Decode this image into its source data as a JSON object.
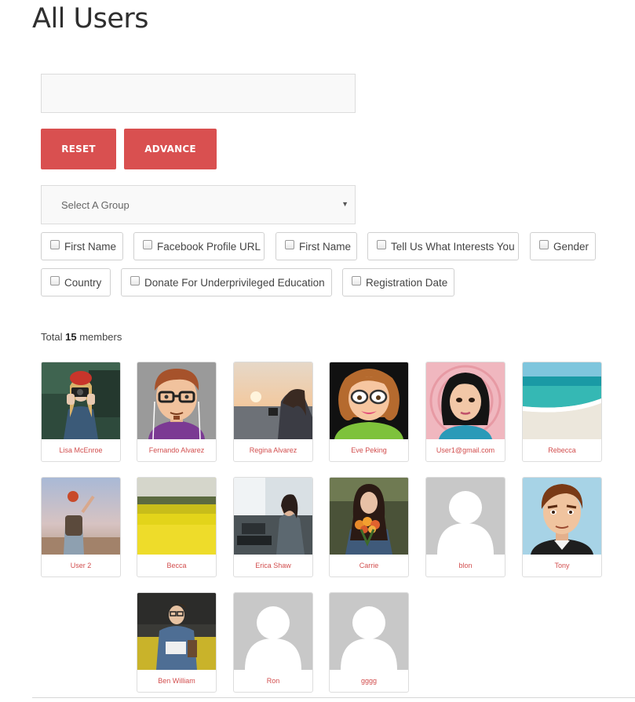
{
  "page": {
    "title": "All Users"
  },
  "search": {
    "value": "",
    "placeholder": ""
  },
  "buttons": {
    "reset": "RESET",
    "advance": "ADVANCE"
  },
  "group_select": {
    "selected": "Select A Group"
  },
  "filters": [
    {
      "label": "First Name",
      "checked": false
    },
    {
      "label": "Facebook Profile URL",
      "checked": false
    },
    {
      "label": "First Name",
      "checked": false
    },
    {
      "label": "Tell Us What Interests You",
      "checked": false
    },
    {
      "label": "Gender",
      "checked": false
    },
    {
      "label": "Country",
      "checked": false
    },
    {
      "label": "Donate For Underprivileged Education",
      "checked": false
    },
    {
      "label": "Registration Date",
      "checked": false
    }
  ],
  "members": {
    "total_prefix": "Total",
    "total_count": "15",
    "total_suffix": "members",
    "items": [
      {
        "name": "Lisa McEnroe",
        "avatar": "photo-woman-camera"
      },
      {
        "name": "Fernando Alvarez",
        "avatar": "cartoon-man-glasses"
      },
      {
        "name": "Regina Alvarez",
        "avatar": "photo-sunset-beach"
      },
      {
        "name": "Eve Peking",
        "avatar": "cartoon-woman-glasses"
      },
      {
        "name": "User1@gmail.com",
        "avatar": "cartoon-woman-dark-hair"
      },
      {
        "name": "Rebecca",
        "avatar": "photo-beach"
      },
      {
        "name": "User 2",
        "avatar": "photo-woman-backpack"
      },
      {
        "name": "Becca",
        "avatar": "photo-yellow-field"
      },
      {
        "name": "Erica Shaw",
        "avatar": "photo-woman-laptop"
      },
      {
        "name": "Carrie",
        "avatar": "photo-woman-flowers"
      },
      {
        "name": "blon",
        "avatar": "default-silhouette"
      },
      {
        "name": "Tony",
        "avatar": "cartoon-man"
      },
      {
        "name": "Ben William",
        "avatar": "photo-man-notebook"
      },
      {
        "name": "Ron",
        "avatar": "default-silhouette"
      },
      {
        "name": "gggg",
        "avatar": "default-silhouette"
      }
    ]
  },
  "colors": {
    "accent": "#d95050",
    "member_name": "#d24e4e",
    "input_bg": "#f9f9f9",
    "border": "#dddddd"
  }
}
